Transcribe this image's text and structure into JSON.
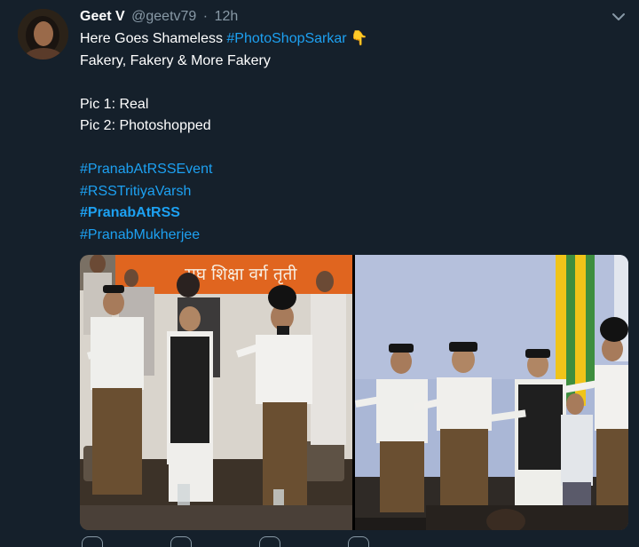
{
  "tweet": {
    "author": {
      "display_name": "Geet V",
      "handle": "@geetv79",
      "separator": "·",
      "time": "12h"
    },
    "menu_icon": "chevron-down-icon",
    "lines": {
      "l1_text": "Here Goes Shameless ",
      "l1_hashtag": "#PhotoShopSarkar",
      "l1_emoji": "👇",
      "l2": "Fakery, Fakery & More Fakery",
      "l3": "Pic 1: Real",
      "l4": "Pic 2: Photoshopped"
    },
    "hashtags": [
      "#PranabAtRSSEvent",
      "#RSSTritiyaVarsh",
      "#PranabAtRSS",
      "#PranabMukherjee"
    ],
    "banner_text": "सघ शिक्षा वर्ग तृती",
    "colors": {
      "background": "#15202b",
      "link": "#1da1f2",
      "muted": "#8899a6"
    }
  }
}
